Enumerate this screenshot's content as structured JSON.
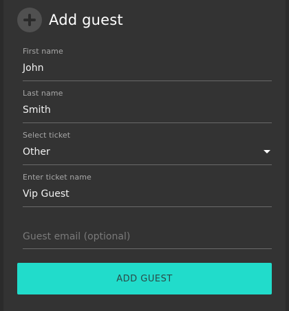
{
  "header": {
    "title": "Add guest",
    "icon": "plus-circle-icon"
  },
  "form": {
    "first_name": {
      "label": "First name",
      "value": "John"
    },
    "last_name": {
      "label": "Last name",
      "value": "Smith"
    },
    "ticket": {
      "label": "Select ticket",
      "value": "Other",
      "icon": "caret-down-icon"
    },
    "ticket_name": {
      "label": "Enter ticket name",
      "value": "Vip Guest"
    },
    "email": {
      "placeholder": "Guest email (optional)",
      "value": ""
    },
    "submit_label": "ADD GUEST"
  },
  "colors": {
    "background": "#333333",
    "accent": "#21dccb",
    "text": "#f2f2f2",
    "label": "#a8a8a8",
    "placeholder": "#7a7a7a",
    "divider": "#6a6a6a"
  }
}
